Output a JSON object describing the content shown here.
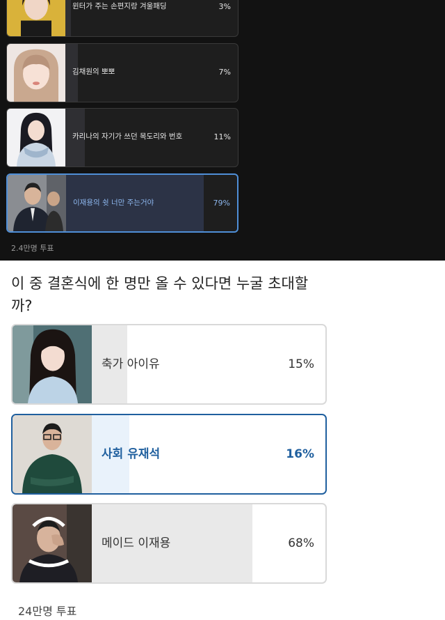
{
  "top_poll": {
    "options": [
      {
        "label": "윈터가 주는 손편지랑 겨울패딩",
        "percent": "3%",
        "fraction": 0.03,
        "selected": false
      },
      {
        "label": "김채원의 뽀뽀",
        "percent": "7%",
        "fraction": 0.07,
        "selected": false
      },
      {
        "label": "카리나의 자기가 쓰던 목도리와 번호",
        "percent": "11%",
        "fraction": 0.11,
        "selected": false
      },
      {
        "label": "이재용의 쉿 너만 주는거야",
        "percent": "79%",
        "fraction": 0.79,
        "selected": true
      }
    ],
    "vote_count": "2.4만명 투표"
  },
  "bottom_poll": {
    "question": "이 중 결혼식에 한 명만 올 수 있다면 누굴 초대할까?",
    "options": [
      {
        "label": "축가 아이유",
        "percent": "15%",
        "fraction": 0.15,
        "selected": false
      },
      {
        "label": "사회 유재석",
        "percent": "16%",
        "fraction": 0.16,
        "selected": true
      },
      {
        "label": "메이드 이재용",
        "percent": "68%",
        "fraction": 0.68,
        "selected": false
      }
    ],
    "vote_count": "24만명 투표"
  },
  "colors": {
    "dark_bg": "#121212",
    "dark_selected_border": "#4f8fd8",
    "light_selected": "#1f5f9e",
    "light_fill": "#e9e9e9"
  }
}
